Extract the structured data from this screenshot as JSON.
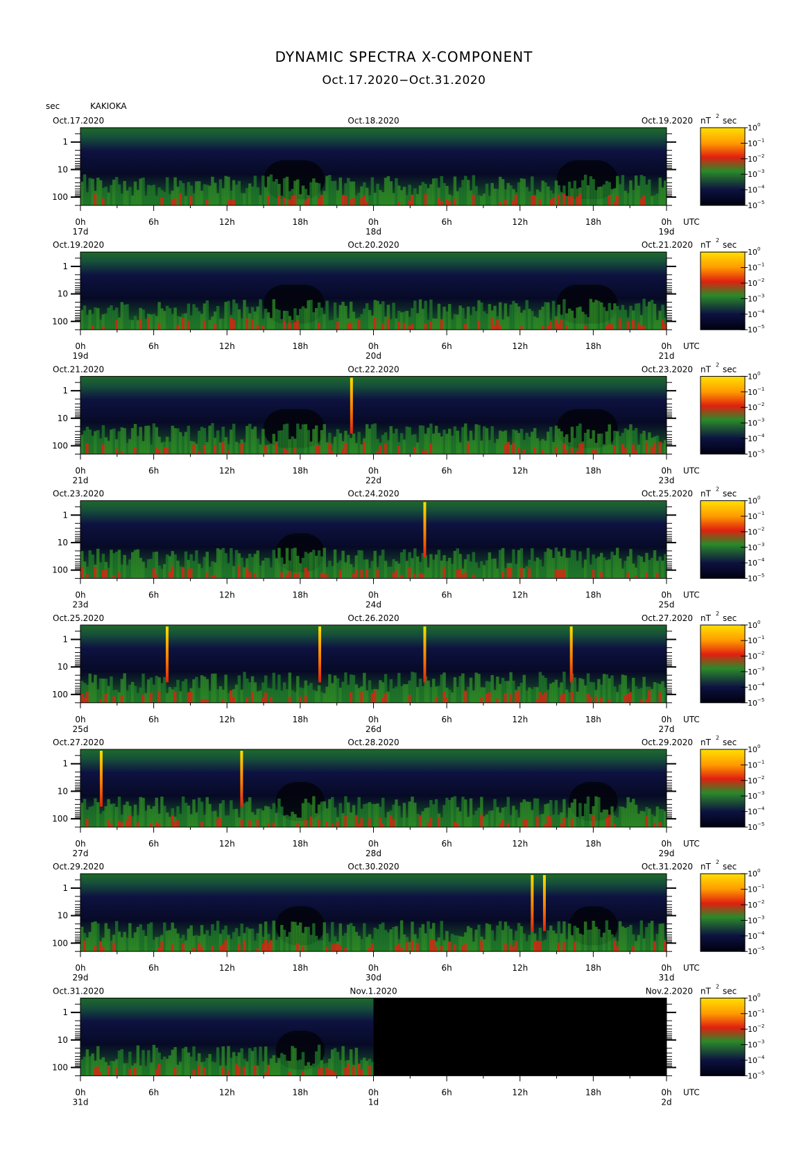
{
  "title": "DYNAMIC SPECTRA X-COMPONENT",
  "subtitle": "Oct.17.2020−Oct.31.2020",
  "y_unit": "sec",
  "station": "KAKIOKA",
  "colorbar_unit": "nT",
  "colorbar_unit_exp": "2",
  "colorbar_unit_tail": "sec",
  "colorbar_ticks": [
    {
      "base": "10",
      "exp": "0"
    },
    {
      "base": "10",
      "exp": "−1"
    },
    {
      "base": "10",
      "exp": "−2"
    },
    {
      "base": "10",
      "exp": "−3"
    },
    {
      "base": "10",
      "exp": "−4"
    },
    {
      "base": "10",
      "exp": "−5"
    }
  ],
  "y_ticks": [
    "1",
    "10",
    "100"
  ],
  "x_ticks": [
    "0h",
    "6h",
    "12h",
    "18h",
    "0h",
    "6h",
    "12h",
    "18h",
    "0h"
  ],
  "utc_label": "UTC",
  "colors": {
    "background": "#000000",
    "low": "#0d1240",
    "mid": "#1f7a2a",
    "high": "#e02010",
    "max": "#ffe000"
  },
  "chart_data": {
    "type": "heatmap",
    "x_unit": "hours UTC",
    "y_unit": "period (sec)",
    "y_scale": "log",
    "ylim": [
      0.3,
      200
    ],
    "color_scale": "log",
    "clim": [
      1e-05,
      1
    ],
    "panels": [
      {
        "left_date": "Oct.17.2020",
        "mid_date": "Oct.18.2020",
        "right_date": "Oct.19.2020",
        "day_labels": [
          "17d",
          "18d",
          "19d"
        ],
        "data_hours": 48,
        "spikes": [],
        "quiet_hours": [
          [
            15,
            20
          ],
          [
            39,
            44
          ]
        ]
      },
      {
        "left_date": "Oct.19.2020",
        "mid_date": "Oct.20.2020",
        "right_date": "Oct.21.2020",
        "day_labels": [
          "19d",
          "20d",
          "21d"
        ],
        "data_hours": 48,
        "spikes": [],
        "quiet_hours": [
          [
            15,
            20
          ],
          [
            39,
            44
          ]
        ]
      },
      {
        "left_date": "Oct.21.2020",
        "mid_date": "Oct.22.2020",
        "right_date": "Oct.23.2020",
        "day_labels": [
          "21d",
          "22d",
          "23d"
        ],
        "data_hours": 48,
        "spikes": [
          22.2
        ],
        "quiet_hours": [
          [
            15,
            20
          ],
          [
            39,
            44
          ]
        ]
      },
      {
        "left_date": "Oct.23.2020",
        "mid_date": "Oct.24.2020",
        "right_date": "Oct.25.2020",
        "day_labels": [
          "23d",
          "24d",
          "25d"
        ],
        "data_hours": 48,
        "spikes": [
          28.2
        ],
        "quiet_hours": [
          [
            16,
            20
          ]
        ]
      },
      {
        "left_date": "Oct.25.2020",
        "mid_date": "Oct.26.2020",
        "right_date": "Oct.27.2020",
        "day_labels": [
          "25d",
          "26d",
          "27d"
        ],
        "data_hours": 48,
        "spikes": [
          7.1,
          19.6,
          28.2,
          40.2
        ],
        "quiet_hours": []
      },
      {
        "left_date": "Oct.27.2020",
        "mid_date": "Oct.28.2020",
        "right_date": "Oct.29.2020",
        "day_labels": [
          "27d",
          "28d",
          "29d"
        ],
        "data_hours": 48,
        "spikes": [
          1.7,
          13.2
        ],
        "quiet_hours": [
          [
            16,
            20
          ],
          [
            40,
            44
          ]
        ]
      },
      {
        "left_date": "Oct.29.2020",
        "mid_date": "Oct.30.2020",
        "right_date": "Oct.31.2020",
        "day_labels": [
          "29d",
          "30d",
          "31d"
        ],
        "data_hours": 48,
        "spikes": [
          37.0,
          38.0
        ],
        "quiet_hours": [
          [
            16,
            20
          ],
          [
            40,
            44
          ]
        ]
      },
      {
        "left_date": "Oct.31.2020",
        "mid_date": "Nov.1.2020",
        "right_date": "Nov.2.2020",
        "day_labels": [
          "31d",
          "1d",
          "2d"
        ],
        "data_hours": 24,
        "spikes": [],
        "quiet_hours": [
          [
            16,
            20
          ]
        ]
      }
    ]
  }
}
